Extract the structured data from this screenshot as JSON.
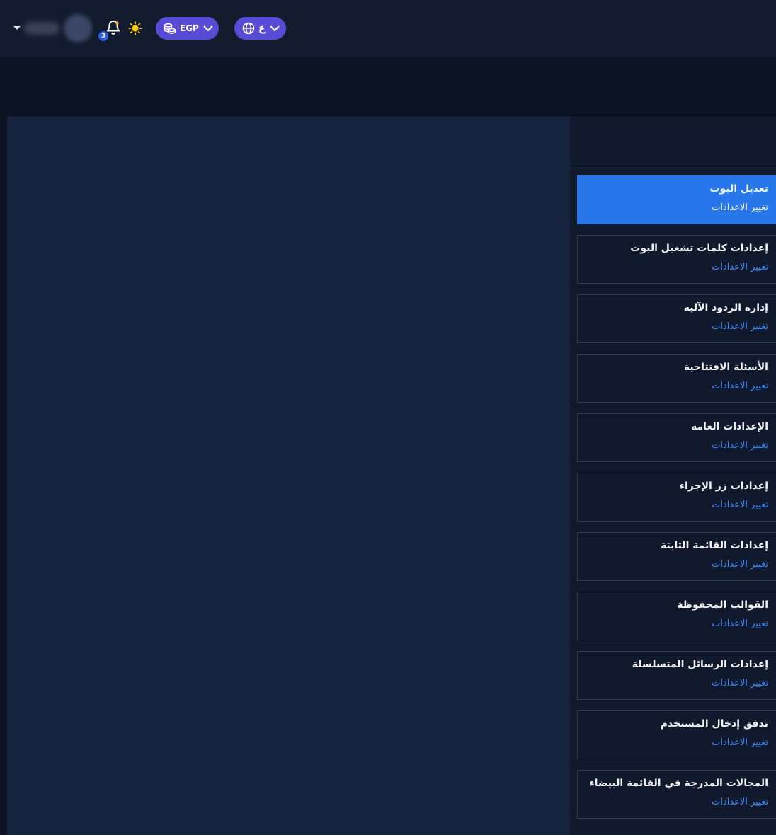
{
  "header": {
    "notifications_count": "3",
    "currency_label": "EGP",
    "language_label": "ع"
  },
  "settings_menu": [
    {
      "title": "تعديل البوت",
      "link": "تغيير الاعدادات",
      "active": true
    },
    {
      "title": "إعدادات كلمات تشغيل البوت",
      "link": "تغيير الاعدادات"
    },
    {
      "title": "إدارة الردود الآلية",
      "link": "تغيير الاعدادات"
    },
    {
      "title": "الأسئلة الافتتاحية",
      "link": "تغيير الاعدادات"
    },
    {
      "title": "الإعدادات العامة",
      "link": "تغيير الاعدادات"
    },
    {
      "title": "إعدادات زر الإجراء",
      "link": "تغيير الاعدادات"
    },
    {
      "title": "إعدادات القائمة الثابتة",
      "link": "تغيير الاعدادات"
    },
    {
      "title": "القوالب المحفوظة",
      "link": "تغيير الاعدادات"
    },
    {
      "title": "إعدادات الرسائل المتسلسلة",
      "link": "تغيير الاعدادات"
    },
    {
      "title": "تدفق إدخال المستخدم",
      "link": "تغيير الاعدادات"
    },
    {
      "title": "المجالات المدرجة في القائمة البيضاء",
      "link": "تغيير الاعدادات"
    }
  ],
  "colors": {
    "accent": "#2777ea",
    "pill": "#5a4bd6",
    "link": "#3b8cff"
  }
}
